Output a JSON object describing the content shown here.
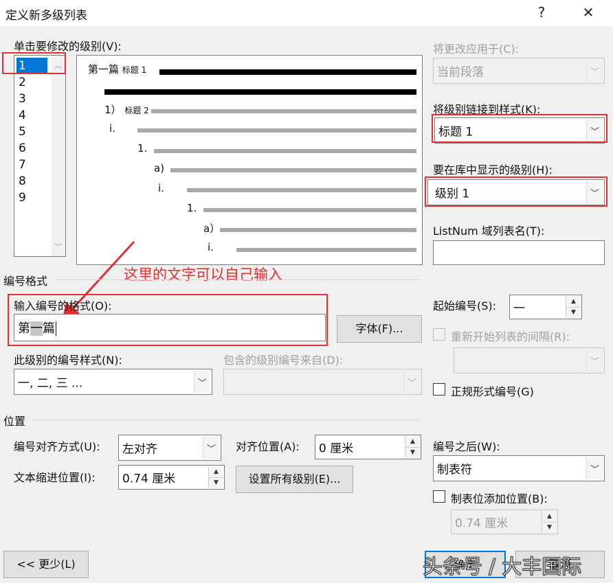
{
  "window": {
    "title": "定义新多级列表",
    "help": "?",
    "close": "✕"
  },
  "level_list": {
    "label": "单击要修改的级别(V):",
    "items": [
      "1",
      "2",
      "3",
      "4",
      "5",
      "6",
      "7",
      "8",
      "9"
    ],
    "selected": "1"
  },
  "preview": {
    "rows": [
      {
        "num": "第一篇",
        "style": "标题 1"
      },
      {
        "num": "1）",
        "style": "标题 2"
      },
      {
        "num": "i."
      },
      {
        "num": "1."
      },
      {
        "num": "a)"
      },
      {
        "num": "i."
      },
      {
        "num": "1."
      },
      {
        "num": "a）"
      },
      {
        "num": "i."
      }
    ]
  },
  "annotation": {
    "text": "这里的文字可以自己输入",
    "color": "#e03030"
  },
  "apply_to": {
    "label": "将更改应用于(C):",
    "value": "当前段落"
  },
  "link_style": {
    "label": "将级别链接到样式(K):",
    "value": "标题 1"
  },
  "gallery_level": {
    "label": "要在库中显示的级别(H):",
    "value": "级别 1"
  },
  "listnum": {
    "label": "ListNum 域列表名(T):",
    "value": ""
  },
  "number_format": {
    "group": "编号格式",
    "input_label": "输入编号的格式(O):",
    "value_prefix": "第",
    "value_number": "一",
    "value_suffix": "篇",
    "font_button": "字体(F)..."
  },
  "start_at": {
    "label": "起始编号(S):",
    "value": "一"
  },
  "restart": {
    "label": "重新开始列表的间隔(R):",
    "value": ""
  },
  "number_style": {
    "label": "此级别的编号样式(N):",
    "value": "一, 二, 三 ..."
  },
  "include_from": {
    "label": "包含的级别编号来自(D):",
    "value": ""
  },
  "legal_style": {
    "label": "正规形式编号(G)"
  },
  "position": {
    "group": "位置",
    "alignment_label": "编号对齐方式(U):",
    "alignment_value": "左对齐",
    "aligned_at_label": "对齐位置(A):",
    "aligned_at_value": "0 厘米",
    "indent_label": "文本缩进位置(I):",
    "indent_value": "0.74 厘米",
    "set_all_button": "设置所有级别(E)..."
  },
  "follow_with": {
    "label": "编号之后(W):",
    "value": "制表符"
  },
  "tab_stop": {
    "label": "制表位添加位置(B):",
    "value": "0.74 厘米"
  },
  "buttons": {
    "less": "<< 更少(L)",
    "ok": "确定",
    "cancel": "取消"
  },
  "watermark": {
    "text": "头条号 / 大丰国际"
  }
}
